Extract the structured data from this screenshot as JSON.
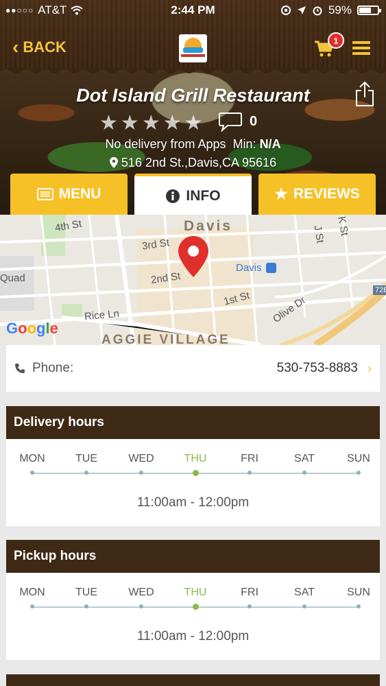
{
  "status_bar": {
    "carrier": "AT&T",
    "time": "2:44 PM",
    "battery": "59%"
  },
  "header": {
    "back_label": "BACK",
    "cart_count": "1"
  },
  "restaurant": {
    "name": "Dot Island Grill Restaurant",
    "review_count": "0",
    "delivery_text": "No delivery from Apps",
    "min_label": "Min:",
    "min_value": "N/A",
    "address": "516 2nd St.,Davis,CA 95616"
  },
  "tabs": [
    {
      "label": "MENU"
    },
    {
      "label": "INFO"
    },
    {
      "label": "REVIEWS"
    }
  ],
  "map": {
    "labels": {
      "town": "Davis",
      "st_4th": "4th St",
      "st_3rd": "3rd St",
      "st_2nd": "2nd St",
      "st_1st": "1st St",
      "station": "Davis",
      "rice": "Rice Ln",
      "olive": "Olive Dr",
      "quad": "Quad",
      "aggie": "AGGIE VILLAGE",
      "j_st": "J St",
      "k_st": "K St",
      "hwy": "72B",
      "google": "Google"
    }
  },
  "contact": {
    "phone_label": "Phone:",
    "phone_number": "530-753-8883"
  },
  "delivery_hours": {
    "title": "Delivery hours",
    "days": [
      "MON",
      "TUE",
      "WED",
      "THU",
      "FRI",
      "SAT",
      "SUN"
    ],
    "hours": "11:00am - 12:00pm"
  },
  "pickup_hours": {
    "title": "Pickup hours",
    "days": [
      "MON",
      "TUE",
      "WED",
      "THU",
      "FRI",
      "SAT",
      "SUN"
    ],
    "hours": "11:00am - 12:00pm"
  },
  "colors": {
    "accent": "#f6c127",
    "header_brown": "#3e2914",
    "today_green": "#8cb84a",
    "pin_red": "#e0302b"
  }
}
